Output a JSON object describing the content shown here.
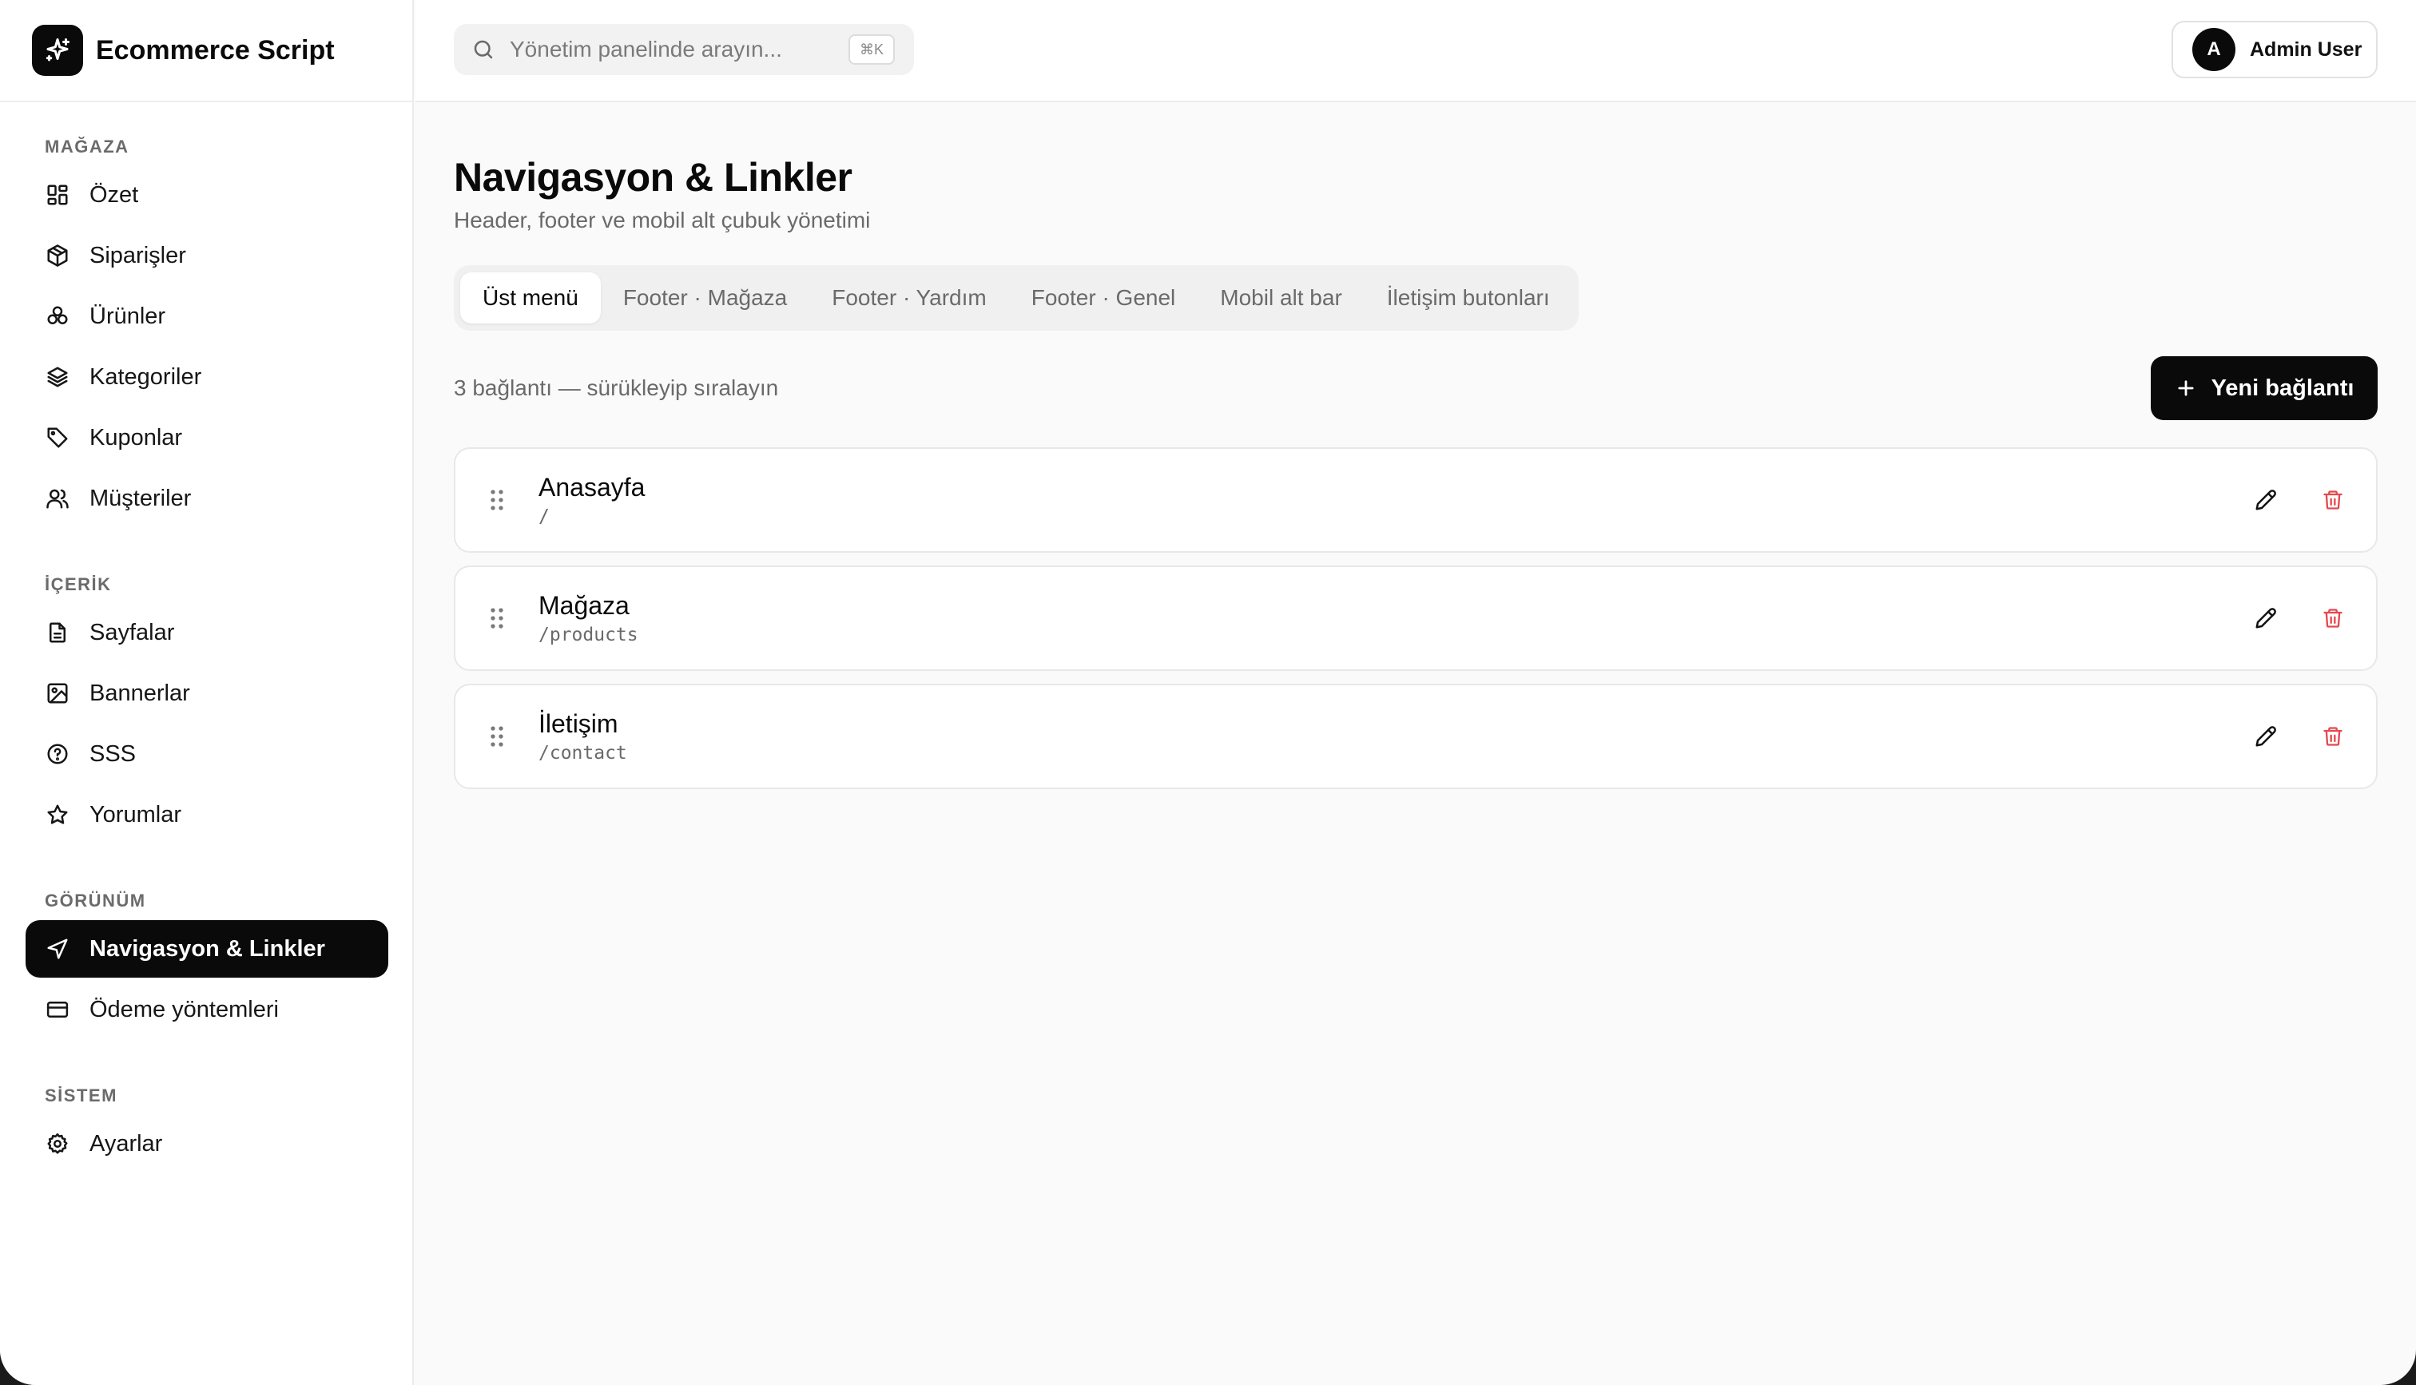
{
  "brand": {
    "name": "Ecommerce Script",
    "icon": "sparkle-icon"
  },
  "search": {
    "placeholder": "Yönetim panelinde arayın...",
    "shortcut": "⌘K"
  },
  "user": {
    "initial": "A",
    "name": "Admin User"
  },
  "sidebar": {
    "sections": [
      {
        "title": "MAĞAZA",
        "items": [
          {
            "label": "Özet",
            "icon": "dashboard-icon"
          },
          {
            "label": "Siparişler",
            "icon": "package-icon"
          },
          {
            "label": "Ürünler",
            "icon": "boxes-icon"
          },
          {
            "label": "Kategoriler",
            "icon": "layers-icon"
          },
          {
            "label": "Kuponlar",
            "icon": "tag-icon"
          },
          {
            "label": "Müşteriler",
            "icon": "users-icon"
          }
        ]
      },
      {
        "title": "İÇERİK",
        "items": [
          {
            "label": "Sayfalar",
            "icon": "file-icon"
          },
          {
            "label": "Bannerlar",
            "icon": "image-icon"
          },
          {
            "label": "SSS",
            "icon": "help-circle-icon"
          },
          {
            "label": "Yorumlar",
            "icon": "star-icon"
          }
        ]
      },
      {
        "title": "GÖRÜNÜM",
        "items": [
          {
            "label": "Navigasyon & Linkler",
            "icon": "navigation-icon",
            "active": true
          },
          {
            "label": "Ödeme yöntemleri",
            "icon": "credit-card-icon"
          }
        ]
      },
      {
        "title": "SİSTEM",
        "items": [
          {
            "label": "Ayarlar",
            "icon": "gear-icon"
          }
        ]
      }
    ]
  },
  "page": {
    "title": "Navigasyon & Linkler",
    "subtitle": "Header, footer ve mobil alt çubuk yönetimi"
  },
  "tabs": [
    {
      "label": "Üst menü",
      "active": true
    },
    {
      "label": "Footer · Mağaza"
    },
    {
      "label": "Footer · Yardım"
    },
    {
      "label": "Footer · Genel"
    },
    {
      "label": "Mobil alt bar"
    },
    {
      "label": "İletişim butonları"
    }
  ],
  "toolbar": {
    "count_text": "3 bağlantı — sürükleyip sıralayın",
    "new_label": "Yeni bağlantı"
  },
  "links": [
    {
      "label": "Anasayfa",
      "path": "/"
    },
    {
      "label": "Mağaza",
      "path": "/products"
    },
    {
      "label": "İletişim",
      "path": "/contact"
    }
  ],
  "colors": {
    "accent": "#0a0a0a",
    "danger": "#e5484d",
    "muted": "#6a6a6a",
    "border": "#e8e8e8"
  }
}
